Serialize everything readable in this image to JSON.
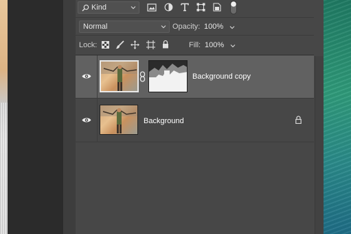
{
  "filter": {
    "kind_label": "Kind",
    "icons": [
      "pixel-filter-icon",
      "adjustment-filter-icon",
      "type-filter-icon",
      "shape-filter-icon",
      "smart-object-filter-icon",
      "filter-toggle-icon"
    ]
  },
  "blend": {
    "mode": "Normal",
    "opacity_label": "Opacity:",
    "opacity_value": "100%"
  },
  "lock": {
    "label": "Lock:",
    "icons": [
      "lock-transparent-pixels-icon",
      "lock-image-pixels-icon",
      "lock-position-icon",
      "lock-artboard-icon",
      "lock-all-icon"
    ],
    "fill_label": "Fill:",
    "fill_value": "100%"
  },
  "layers": [
    {
      "name": "Background copy",
      "visible": true,
      "selected": true,
      "has_mask": true,
      "locked": false
    },
    {
      "name": "Background",
      "visible": true,
      "selected": false,
      "has_mask": false,
      "locked": true
    }
  ],
  "colors": {
    "panel_bg": "#474747",
    "selected_row": "#616161",
    "text": "#ffffff"
  }
}
